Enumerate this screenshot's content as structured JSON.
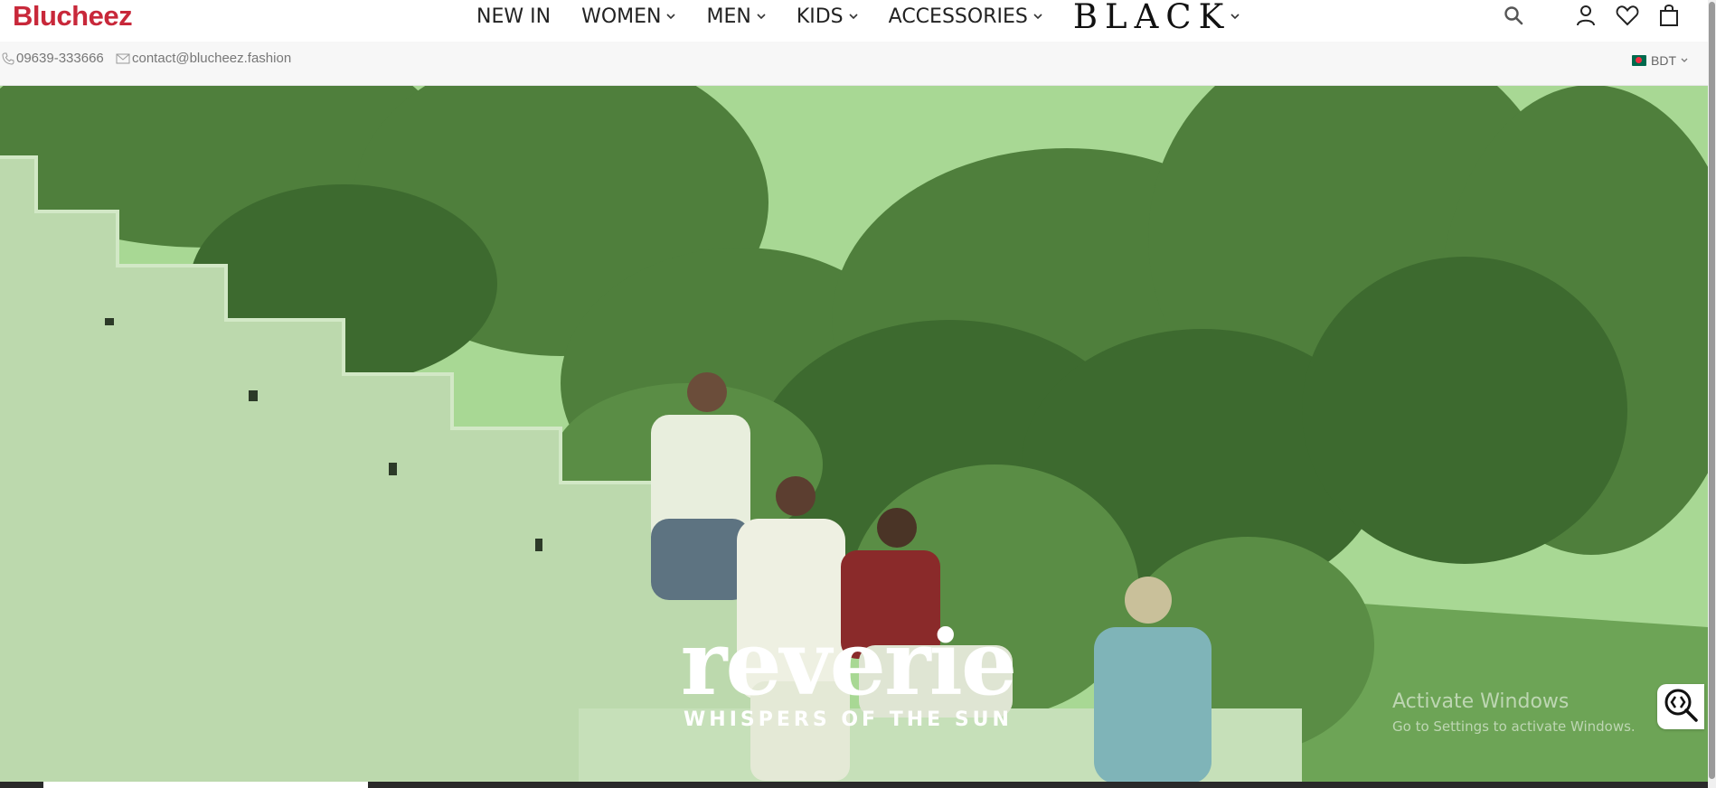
{
  "brand": {
    "logo_text": "Blucheez",
    "color": "#c8283a"
  },
  "nav": {
    "items": [
      {
        "label": "NEW IN",
        "has_dropdown": false
      },
      {
        "label": "WOMEN",
        "has_dropdown": true
      },
      {
        "label": "MEN",
        "has_dropdown": true
      },
      {
        "label": "KIDS",
        "has_dropdown": true
      },
      {
        "label": "ACCESSORIES",
        "has_dropdown": true
      },
      {
        "label": "BLACK",
        "has_dropdown": true
      }
    ]
  },
  "header_icons": [
    "search-icon",
    "user-icon",
    "heart-icon",
    "shopping-bag-icon"
  ],
  "infobar": {
    "phone": "09639-333666",
    "email": "contact@blucheez.fashion",
    "currency": "BDT"
  },
  "hero": {
    "title": "reverie",
    "subtitle": "WHISPERS OF THE SUN",
    "tint_color": "#9fcf8c",
    "video_progress": 0.2
  },
  "os_watermark": {
    "line1": "Activate Windows",
    "line2": "Go to Settings to activate Windows."
  }
}
